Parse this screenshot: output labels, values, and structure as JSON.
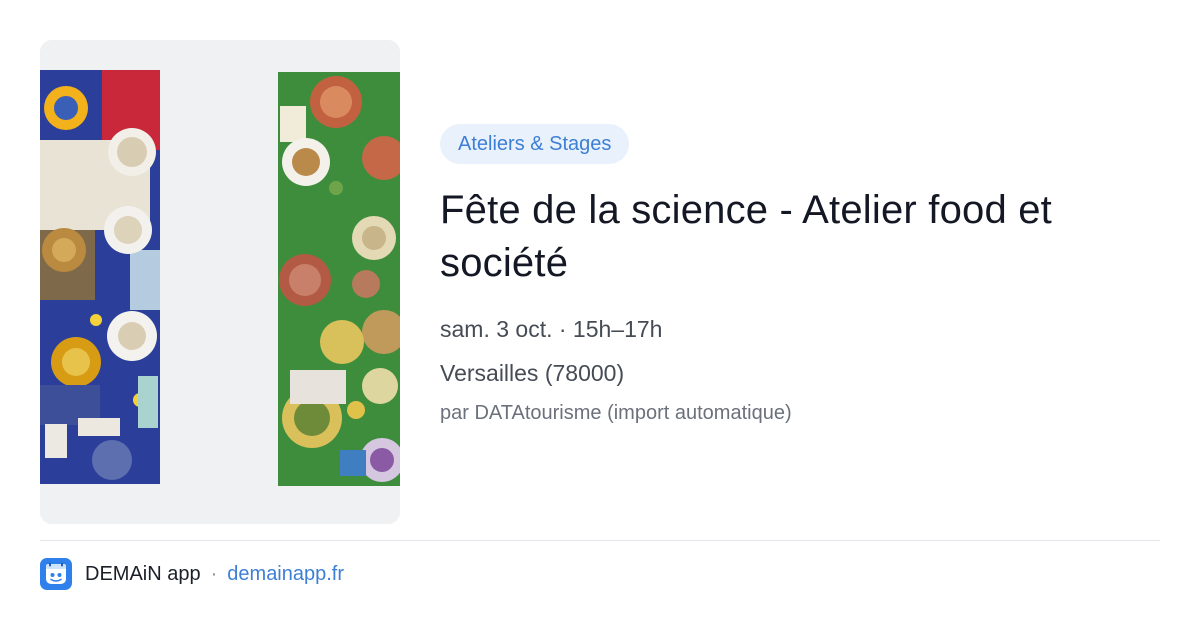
{
  "event": {
    "category": "Ateliers & Stages",
    "title": "Fête de la science - Atelier food et société",
    "when": "sam. 3 oct. · 15h–17h",
    "where": "Versailles (78000)",
    "source": "par DATAtourisme (import automatique)"
  },
  "footer": {
    "app_name": "DEMAiN app",
    "separator": "·",
    "link": "demainapp.fr"
  },
  "colors": {
    "chip_bg": "#e8f1fc",
    "accent": "#3d7fd4",
    "title": "#141824",
    "logo_bg": "#2f80ea"
  },
  "icons": {
    "logo": "demain-app-logo-icon"
  }
}
